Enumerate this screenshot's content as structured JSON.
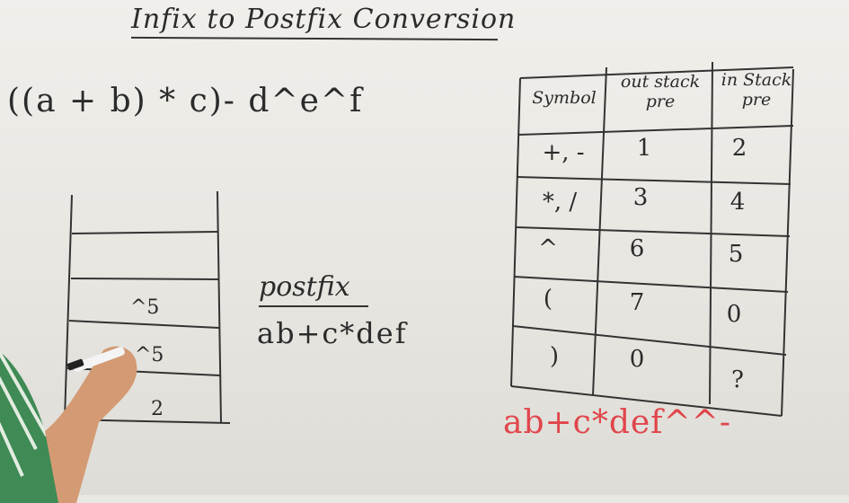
{
  "title": "Infix to Postfix Conversion",
  "expression": "((a + b) * c)- d^e^f",
  "stack": {
    "entries": [
      "^5",
      "^5",
      "2"
    ]
  },
  "postfix": {
    "label": "postfix",
    "value": "ab+c*def"
  },
  "precedence_table": {
    "headers": [
      "Symbol",
      "out stack pre",
      "in Stack pre"
    ],
    "rows": [
      {
        "symbol": "+, -",
        "out": "1",
        "in": "2"
      },
      {
        "symbol": "*, /",
        "out": "3",
        "in": "4"
      },
      {
        "symbol": "^",
        "out": "6",
        "in": "5"
      },
      {
        "symbol": "(",
        "out": "7",
        "in": "0"
      },
      {
        "symbol": ")",
        "out": "0",
        "in": "?"
      }
    ]
  },
  "final_output": "ab+c*def^^-",
  "colors": {
    "ink": "#2a2a2a",
    "red_marker": "#e0454b",
    "board": "#ebe9e4"
  }
}
